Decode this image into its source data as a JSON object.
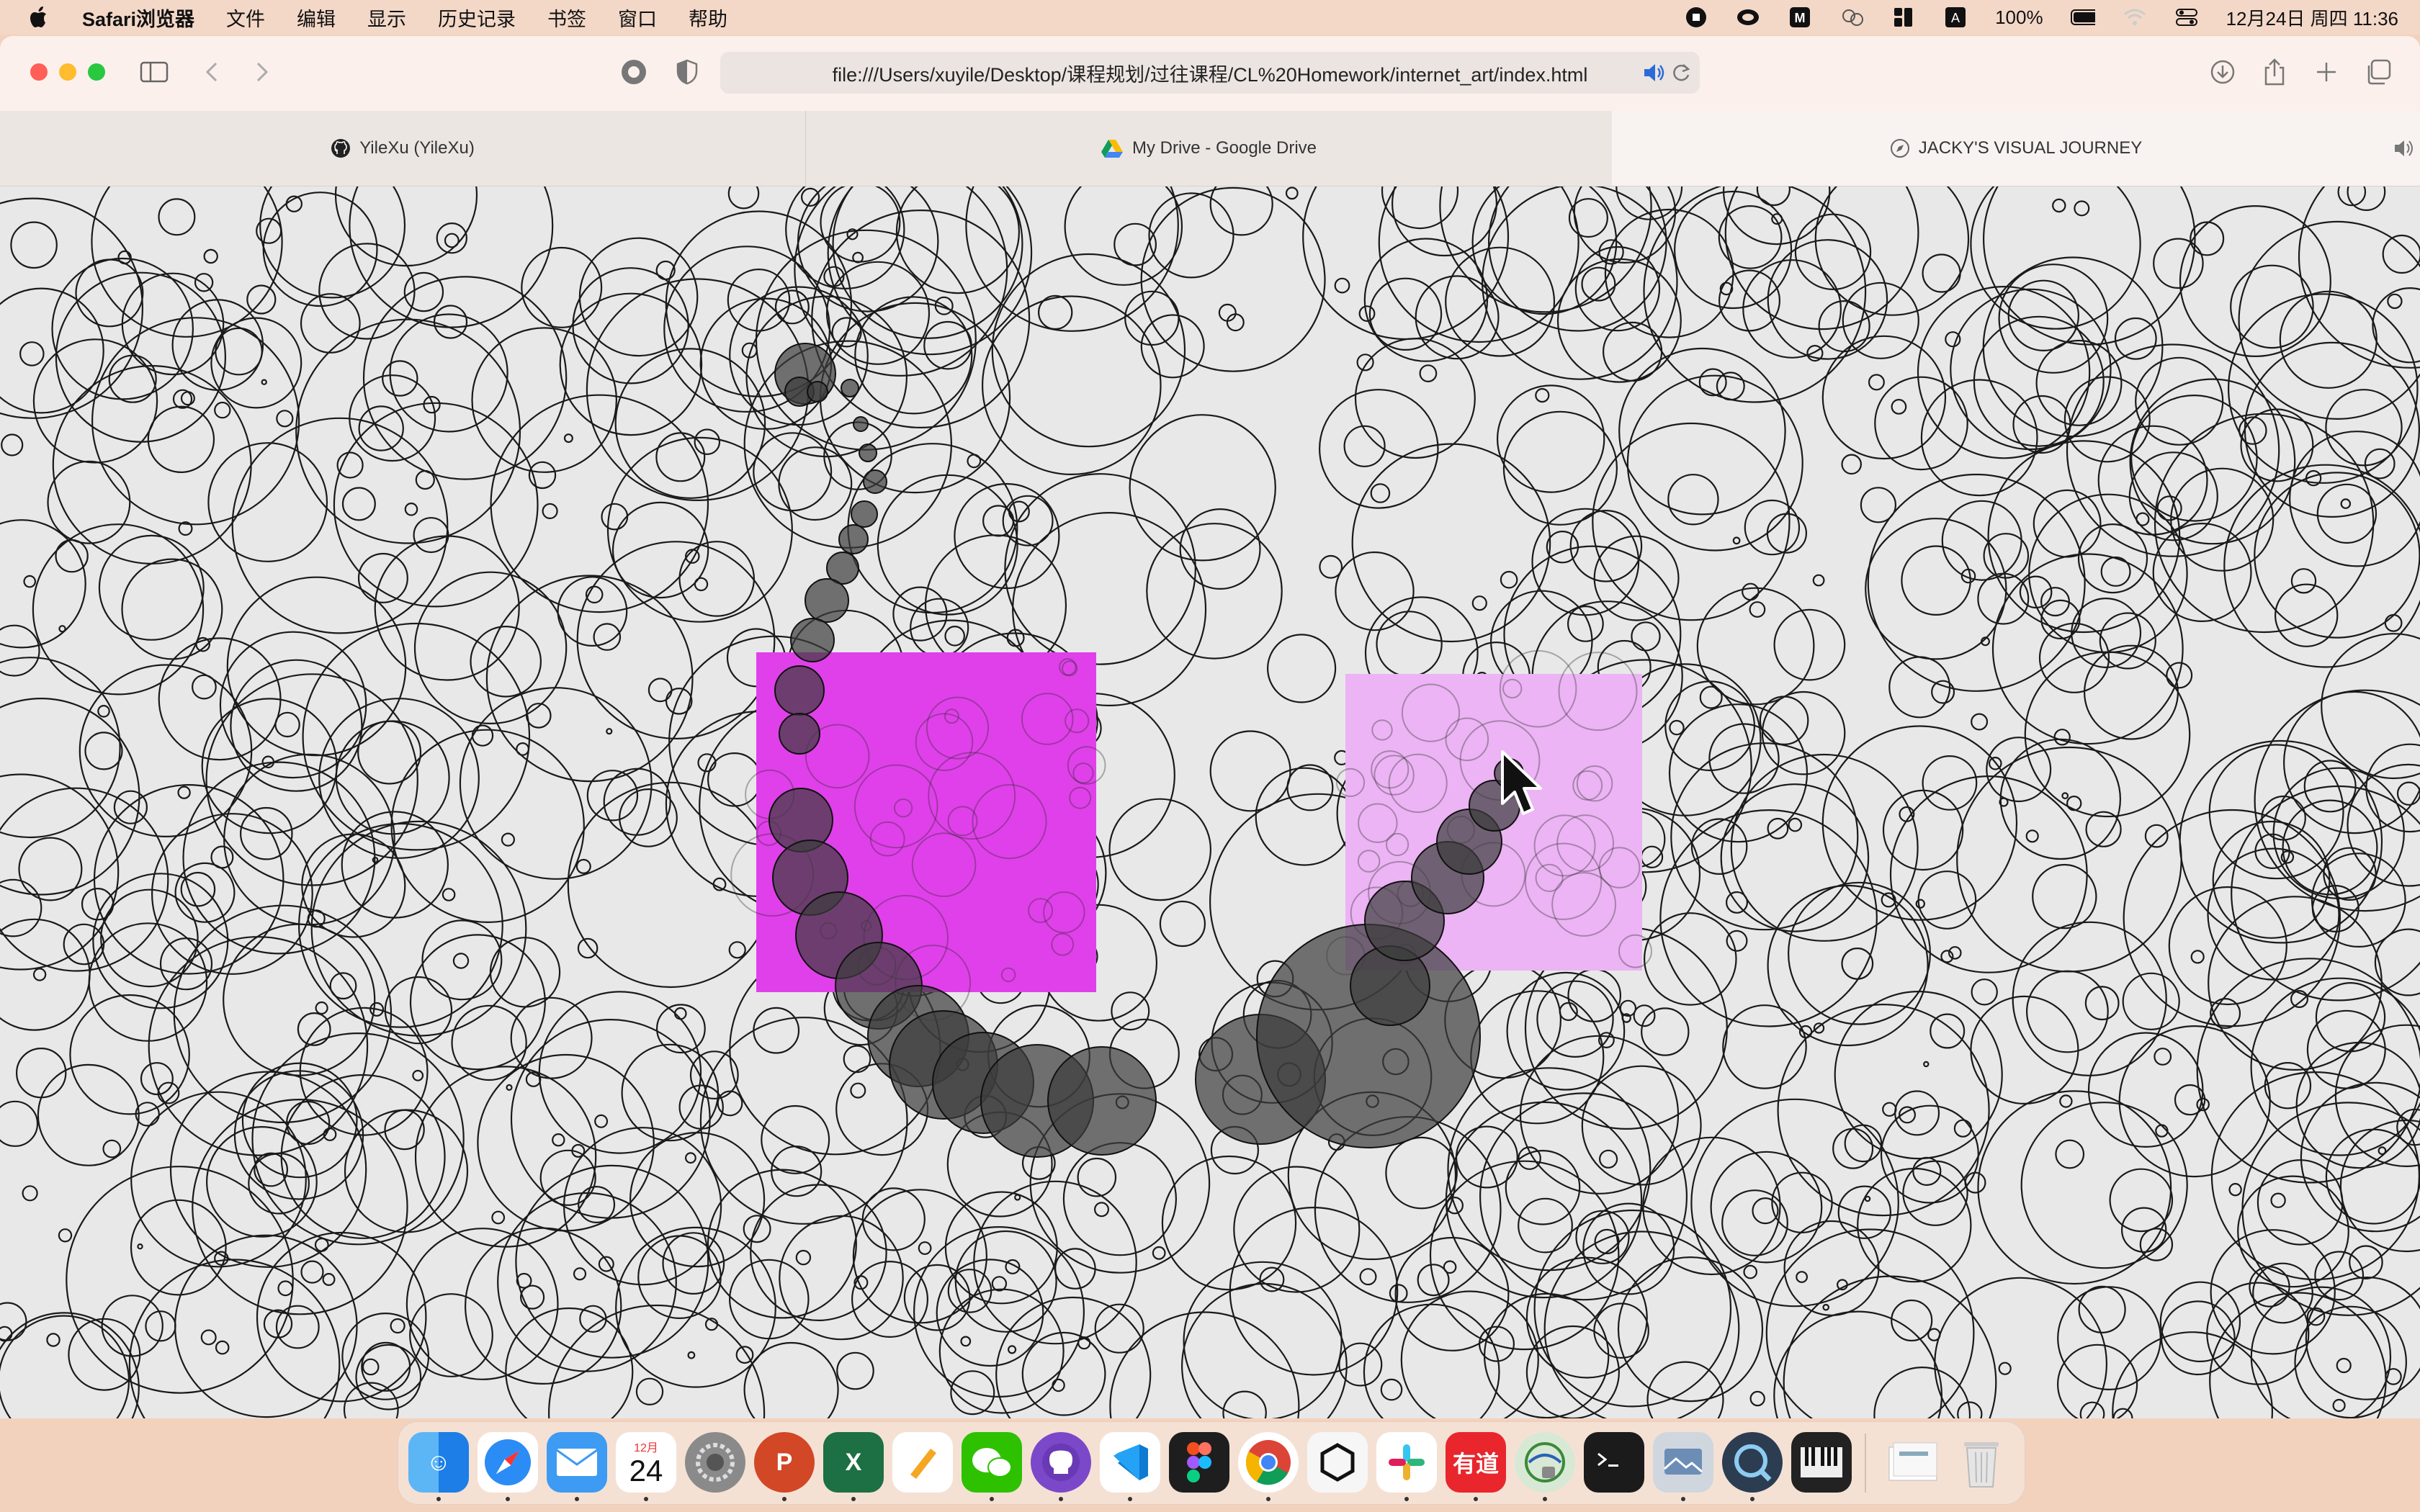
{
  "menubar": {
    "app_name": "Safari浏览器",
    "items": [
      "文件",
      "编辑",
      "显示",
      "历史记录",
      "书签",
      "窗口",
      "帮助"
    ],
    "battery": "100%",
    "datetime": "12月24日 周四 11:36"
  },
  "toolbar": {
    "url": "file:///Users/xuyile/Desktop/课程规划/过往课程/CL%20Homework/internet_art/index.html"
  },
  "tabs": [
    {
      "label": "YileXu (YileXu)",
      "icon": "github-icon"
    },
    {
      "label": "My Drive - Google Drive",
      "icon": "google-drive-icon"
    },
    {
      "label": "JACKY'S VISUAL JOURNEY",
      "icon": "compass-icon"
    }
  ],
  "canvas": {
    "background": "#e8e8e8",
    "square_colors": [
      "#e040ea",
      "#ecb4f4"
    ],
    "blob_color": "rgba(60,60,60,0.7)"
  },
  "dock": {
    "calendar_month": "12月",
    "calendar_day": "24",
    "youdao_label": "有道",
    "apps": [
      "finder",
      "safari",
      "mail",
      "calendar",
      "system-settings",
      "powerpoint",
      "excel",
      "pages",
      "wechat",
      "github-desktop",
      "vscode",
      "figma",
      "chrome",
      "unity",
      "slack",
      "youdao",
      "network",
      "terminal",
      "preview",
      "quicktime",
      "piano",
      "downloads",
      "trash"
    ]
  }
}
